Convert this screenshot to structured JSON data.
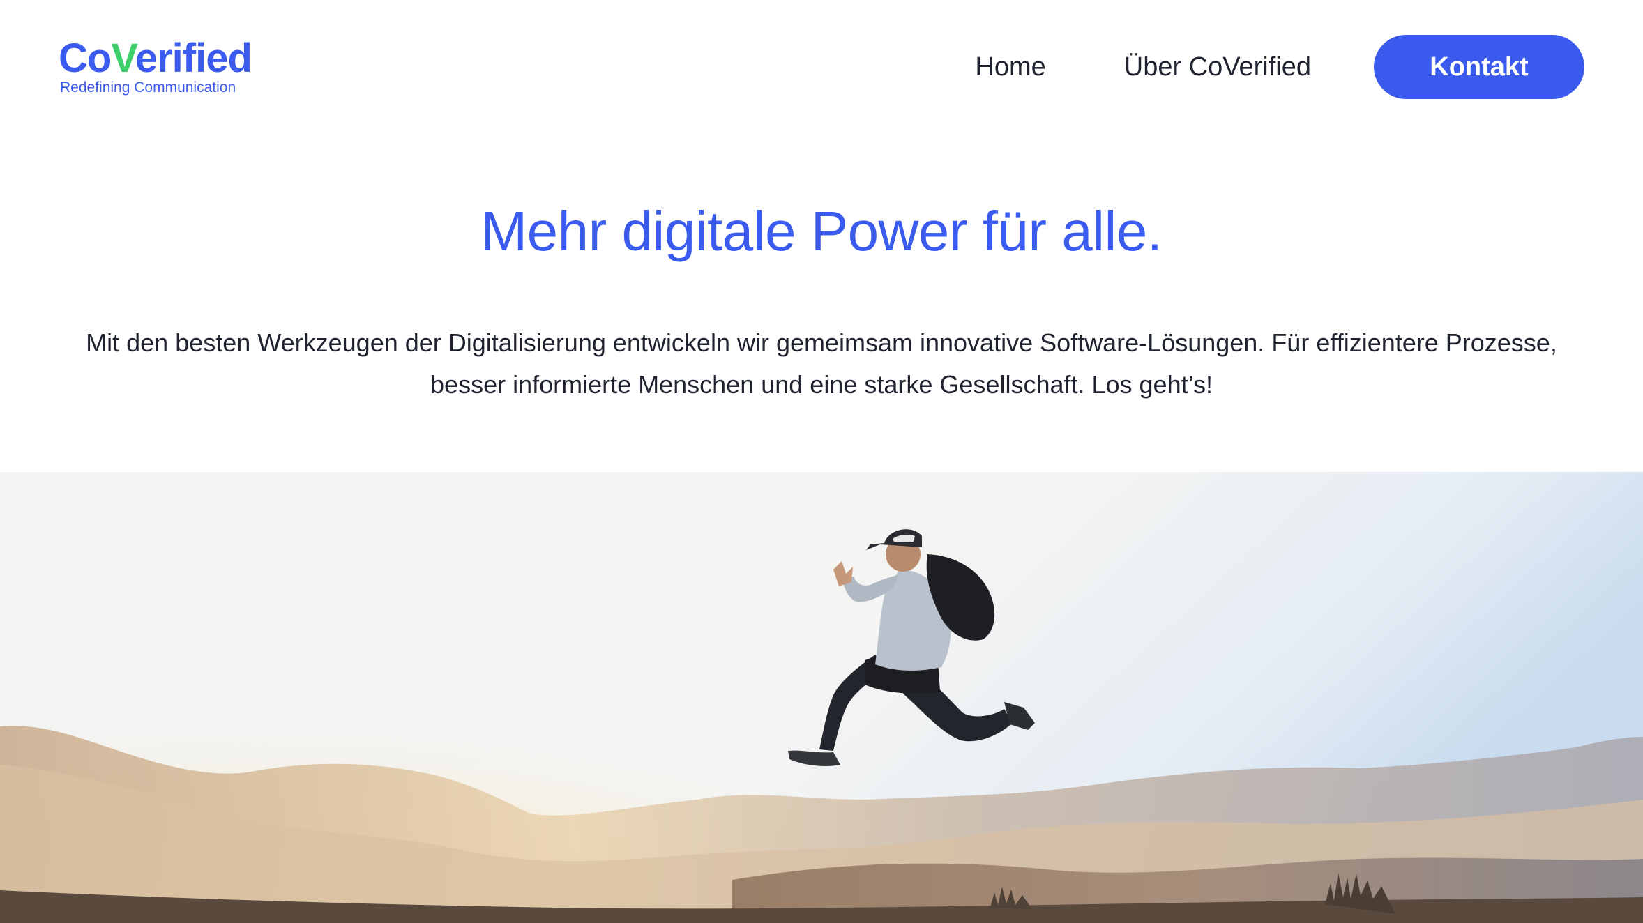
{
  "header": {
    "logo": {
      "prefix": "Co",
      "check": "V",
      "suffix": "erified",
      "tagline": "Redefining Communication"
    },
    "nav": {
      "home": "Home",
      "about": "Über CoVerified",
      "contact": "Kontakt"
    }
  },
  "hero": {
    "title": "Mehr digitale Power für alle.",
    "text": "Mit den besten Werkzeugen der Digitalisierung entwickeln wir gemeimsam innovative Software-Lösungen. Für effizientere Prozesse, besser informierte Menschen und eine starke Gesellschaft. Los geht’s!"
  },
  "colors": {
    "brand": "#3b5bee",
    "check": "#3ecf6b",
    "text": "#1f2330"
  }
}
